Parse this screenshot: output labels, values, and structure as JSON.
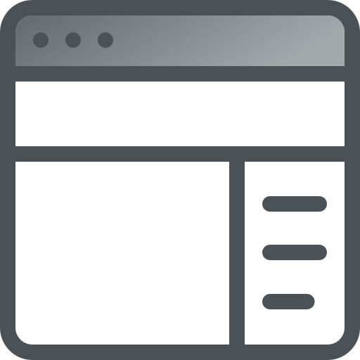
{
  "icon": {
    "name": "browser-window-layout-icon",
    "colors": {
      "outline": "#4a5257",
      "titlebar_light": "#a3a8ab",
      "titlebar_dark": "#616a70",
      "fill": "#ffffff"
    }
  },
  "window": {
    "control_dots": [
      "dot",
      "dot",
      "dot"
    ]
  },
  "sidebar": {
    "lines": [
      {
        "relative_length": 1.0
      },
      {
        "relative_length": 1.0
      },
      {
        "relative_length": 0.75
      }
    ]
  }
}
